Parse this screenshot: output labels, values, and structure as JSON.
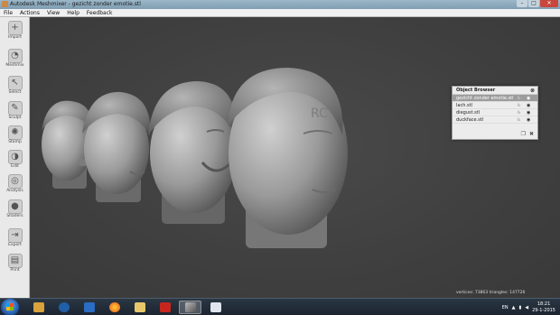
{
  "window": {
    "title": "Autodesk Meshmixer - gezicht zonder emotie.stl",
    "controls": [
      "–",
      "□",
      "✕"
    ]
  },
  "menu": [
    "File",
    "Actions",
    "View",
    "Help",
    "Feedback"
  ],
  "toolbar": [
    {
      "label": "Import",
      "icon": "plus-icon",
      "glyph": "+"
    },
    {
      "label": "Meshmix",
      "icon": "meshmix-icon",
      "glyph": "◔"
    },
    {
      "label": "Select",
      "icon": "select-icon",
      "glyph": "↖"
    },
    {
      "label": "Sculpt",
      "icon": "sculpt-icon",
      "glyph": "✎"
    },
    {
      "label": "Stamp",
      "icon": "stamp-icon",
      "glyph": "✺"
    },
    {
      "label": "Edit",
      "icon": "edit-icon",
      "glyph": "◑"
    },
    {
      "label": "Analysis",
      "icon": "analysis-icon",
      "glyph": "◎"
    },
    {
      "label": "Shaders",
      "icon": "shaders-icon",
      "glyph": "●"
    },
    {
      "label": "Export",
      "icon": "export-icon",
      "glyph": "⇥"
    },
    {
      "label": "Print",
      "icon": "print-icon",
      "glyph": "▤"
    }
  ],
  "browser": {
    "title": "Object Browser",
    "items": [
      {
        "name": "gezicht zonder emotie.stl",
        "selected": true
      },
      {
        "name": "lach.stl",
        "selected": false
      },
      {
        "name": "diegust.stl",
        "selected": false
      },
      {
        "name": "duckface.stl",
        "selected": false
      }
    ]
  },
  "status": "vertices: 73863 triangles: 147726",
  "taskbar": {
    "apps": [
      "Media Player",
      "HP",
      "Outlook",
      "Firefox",
      "Explorer",
      "Acrobat",
      "Meshmixer",
      "Notepad"
    ],
    "language": "EN",
    "time": "18:21",
    "date": "29-1-2015"
  },
  "colors": {
    "viewport": "#3f3f3f",
    "toolbar": "#e9e9e9",
    "mesh": "#a9a9a9"
  }
}
